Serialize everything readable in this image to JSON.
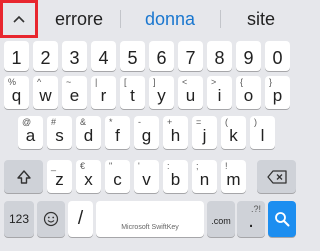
{
  "suggestions": {
    "left": "errore",
    "middle": "donna",
    "right": "site"
  },
  "icons": {
    "expand": "chevron-up-icon",
    "shift": "shift-arrow-icon",
    "backspace": "backspace-icon",
    "emoji": "smiley-icon",
    "search": "search-icon"
  },
  "colors": {
    "highlight_border": "#e8262e",
    "suggestion_accent": "#1a77cf",
    "action_key": "#1c8ef0"
  },
  "keyboard": {
    "numbers": [
      "1",
      "2",
      "3",
      "4",
      "5",
      "6",
      "7",
      "8",
      "9",
      "0"
    ],
    "row1": [
      {
        "key": "q",
        "hint": "%"
      },
      {
        "key": "w",
        "hint": "^"
      },
      {
        "key": "e",
        "hint": "~"
      },
      {
        "key": "r",
        "hint": "|"
      },
      {
        "key": "t",
        "hint": "["
      },
      {
        "key": "y",
        "hint": "]"
      },
      {
        "key": "u",
        "hint": "<"
      },
      {
        "key": "i",
        "hint": ">"
      },
      {
        "key": "o",
        "hint": "{"
      },
      {
        "key": "p",
        "hint": "}"
      }
    ],
    "row2": [
      {
        "key": "a",
        "hint": "@"
      },
      {
        "key": "s",
        "hint": "#"
      },
      {
        "key": "d",
        "hint": "&"
      },
      {
        "key": "f",
        "hint": "*"
      },
      {
        "key": "g",
        "hint": "-"
      },
      {
        "key": "h",
        "hint": "+"
      },
      {
        "key": "j",
        "hint": "="
      },
      {
        "key": "k",
        "hint": "("
      },
      {
        "key": "l",
        "hint": ")"
      }
    ],
    "row3": [
      {
        "key": "z",
        "hint": "_"
      },
      {
        "key": "x",
        "hint": "€"
      },
      {
        "key": "c",
        "hint": "\""
      },
      {
        "key": "v",
        "hint": "'"
      },
      {
        "key": "b",
        "hint": ":"
      },
      {
        "key": "n",
        "hint": ";"
      },
      {
        "key": "m",
        "hint": "!"
      }
    ],
    "bottom": {
      "mode_label": "123",
      "slash_label": "/",
      "space_label": "Microsoft SwiftKey",
      "com_label": ".com",
      "period_label": ".",
      "period_hint": ".?!"
    }
  }
}
